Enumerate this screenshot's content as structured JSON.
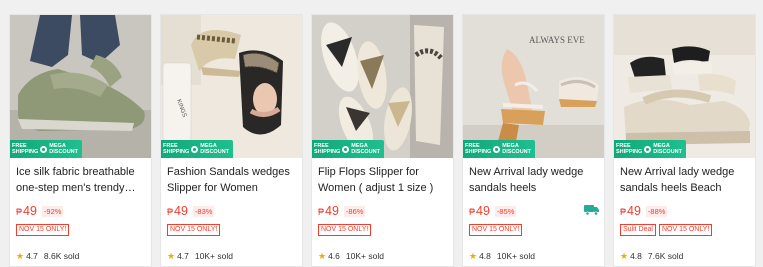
{
  "promo": {
    "free": "FREE",
    "shipping": "SHIPPING",
    "mega": "MEGA",
    "discount": "DISCOUNT"
  },
  "currency": "₱",
  "products": [
    {
      "title": "Ice silk fabric breathable one-step men's trendy…",
      "price": "49",
      "discount": "-92%",
      "tags": [
        "NOV 15 ONLY!"
      ],
      "rating": "4.7",
      "sold": "8.6K sold"
    },
    {
      "title": "Fashion Sandals wedges Slipper for Women",
      "price": "49",
      "discount": "-83%",
      "tags": [
        "NOV 15 ONLY!"
      ],
      "rating": "4.7",
      "sold": "10K+ sold"
    },
    {
      "title": "Flip Flops Slipper for Women ( adjust 1 size )",
      "price": "49",
      "discount": "-86%",
      "tags": [
        "NOV 15 ONLY!"
      ],
      "rating": "4.6",
      "sold": "10K+ sold"
    },
    {
      "title": "New Arrival lady wedge sandals heels",
      "price": "49",
      "discount": "-85%",
      "tags": [
        "NOV 15 ONLY!"
      ],
      "rating": "4.8",
      "sold": "10K+ sold"
    },
    {
      "title": "New Arrival lady wedge sandals heels Beach sandal",
      "price": "49",
      "discount": "-88%",
      "tags": [
        "Sulit Deal",
        "NOV 15 ONLY!"
      ],
      "rating": "4.8",
      "sold": "7.6K sold"
    }
  ],
  "image_texts": {
    "p1_box": "KINGS",
    "p3_wall": "ALWAYS  EVE"
  },
  "colors": {
    "price": "#f53d2d",
    "promo": "#12a87a",
    "star": "#f6a700",
    "cart_badge": "#26aa99"
  }
}
